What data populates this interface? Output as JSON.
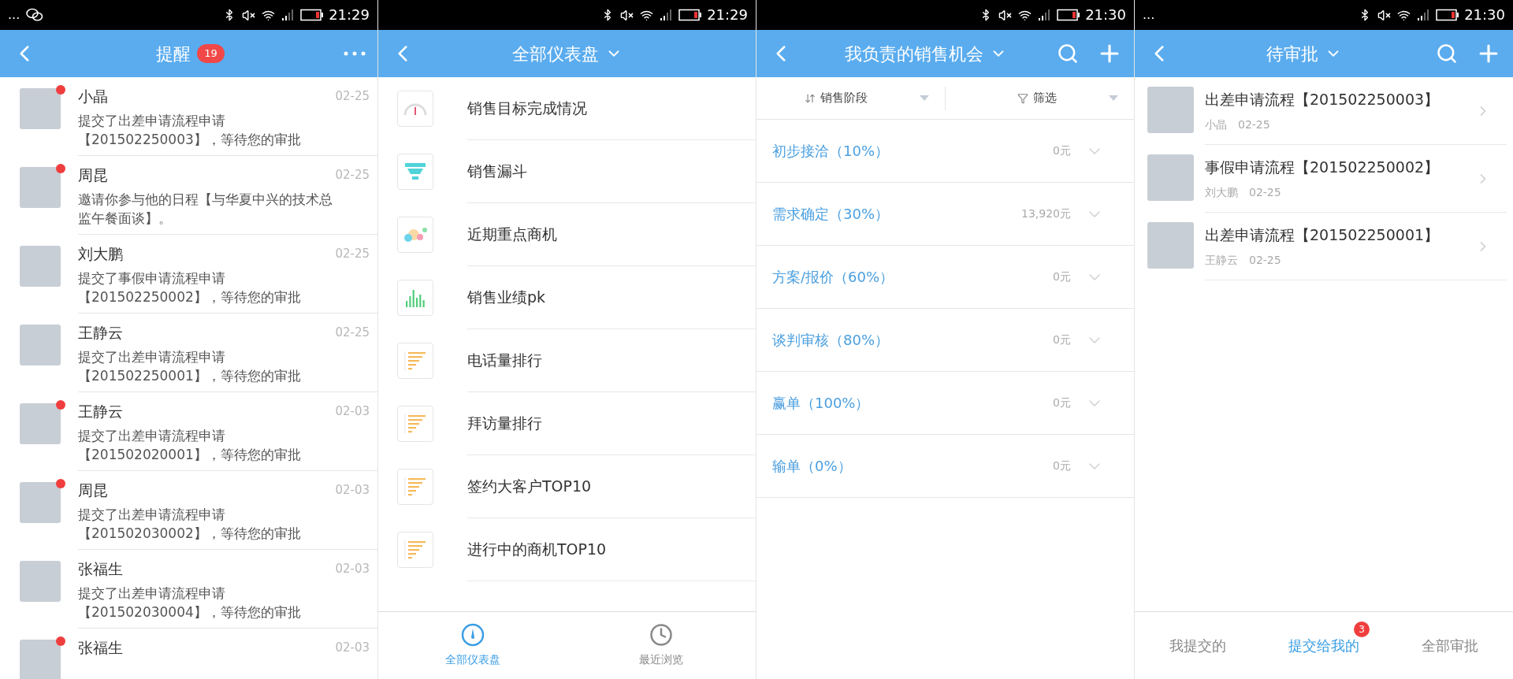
{
  "reminders": {
    "status_bar": {
      "left": "...",
      "time": "21:29"
    },
    "header": {
      "title": "提醒",
      "badge": "19"
    },
    "items": [
      {
        "name": "小晶",
        "date": "02-25",
        "message": "提交了出差申请流程申请【201502250003】，等待您的审批",
        "unread": true
      },
      {
        "name": "周昆",
        "date": "02-25",
        "message": "邀请你参与他的日程【与华夏中兴的技术总监午餐面谈】。",
        "unread": true
      },
      {
        "name": "刘大鹏",
        "date": "02-25",
        "message": "提交了事假申请流程申请【201502250002】，等待您的审批",
        "unread": false
      },
      {
        "name": "王静云",
        "date": "02-25",
        "message": "提交了出差申请流程申请【201502250001】，等待您的审批",
        "unread": false
      },
      {
        "name": "王静云",
        "date": "02-03",
        "message": "提交了出差申请流程申请【201502020001】，等待您的审批",
        "unread": true
      },
      {
        "name": "周昆",
        "date": "02-03",
        "message": "提交了出差申请流程申请【201502030002】，等待您的审批",
        "unread": true
      },
      {
        "name": "张福生",
        "date": "02-03",
        "message": "提交了出差申请流程申请【201502030004】，等待您的审批",
        "unread": false
      },
      {
        "name": "张福生",
        "date": "02-03",
        "unread": true
      }
    ]
  },
  "dashboards": {
    "status_bar": {
      "time": "21:29"
    },
    "header": {
      "title": "全部仪表盘"
    },
    "items": [
      {
        "label": "销售目标完成情况",
        "kind": "gauge"
      },
      {
        "label": "销售漏斗",
        "kind": "funnel"
      },
      {
        "label": "近期重点商机",
        "kind": "bubbles"
      },
      {
        "label": "销售业绩pk",
        "kind": "bars"
      },
      {
        "label": "电话量排行",
        "kind": "ranking"
      },
      {
        "label": "拜访量排行",
        "kind": "ranking"
      },
      {
        "label": "签约大客户TOP10",
        "kind": "ranking"
      },
      {
        "label": "进行中的商机TOP10",
        "kind": "ranking"
      }
    ],
    "tabs": [
      {
        "label": "全部仪表盘",
        "kind": "dashboard",
        "selected": true
      },
      {
        "label": "最近浏览",
        "kind": "recent",
        "selected": false
      }
    ]
  },
  "opportunities": {
    "status_bar": {
      "time": "21:30"
    },
    "header": {
      "title": "我负责的销售机会"
    },
    "filters": [
      {
        "label": "销售阶段",
        "kind": "sort"
      },
      {
        "label": "筛选",
        "kind": "filter"
      }
    ],
    "stages": [
      {
        "label": "初步接洽（10%）",
        "amount": "0元"
      },
      {
        "label": "需求确定（30%）",
        "amount": "13,920元"
      },
      {
        "label": "方案/报价（60%）",
        "amount": "0元"
      },
      {
        "label": "谈判审核（80%）",
        "amount": "0元"
      },
      {
        "label": "赢单（100%）",
        "amount": "0元"
      },
      {
        "label": "输单（0%）",
        "amount": "0元"
      }
    ]
  },
  "approvals": {
    "status_bar": {
      "left": "...",
      "time": "21:30"
    },
    "header": {
      "title": "待审批"
    },
    "items": [
      {
        "title": "出差申请流程【201502250003】",
        "name": "小晶",
        "date": "02-25"
      },
      {
        "title": "事假申请流程【201502250002】",
        "name": "刘大鹏",
        "date": "02-25"
      },
      {
        "title": "出差申请流程【201502250001】",
        "name": "王静云",
        "date": "02-25"
      }
    ],
    "tabs": [
      {
        "label": "我提交的",
        "selected": false
      },
      {
        "label": "提交给我的",
        "selected": true,
        "badge": "3"
      },
      {
        "label": "全部审批",
        "selected": false
      }
    ]
  }
}
